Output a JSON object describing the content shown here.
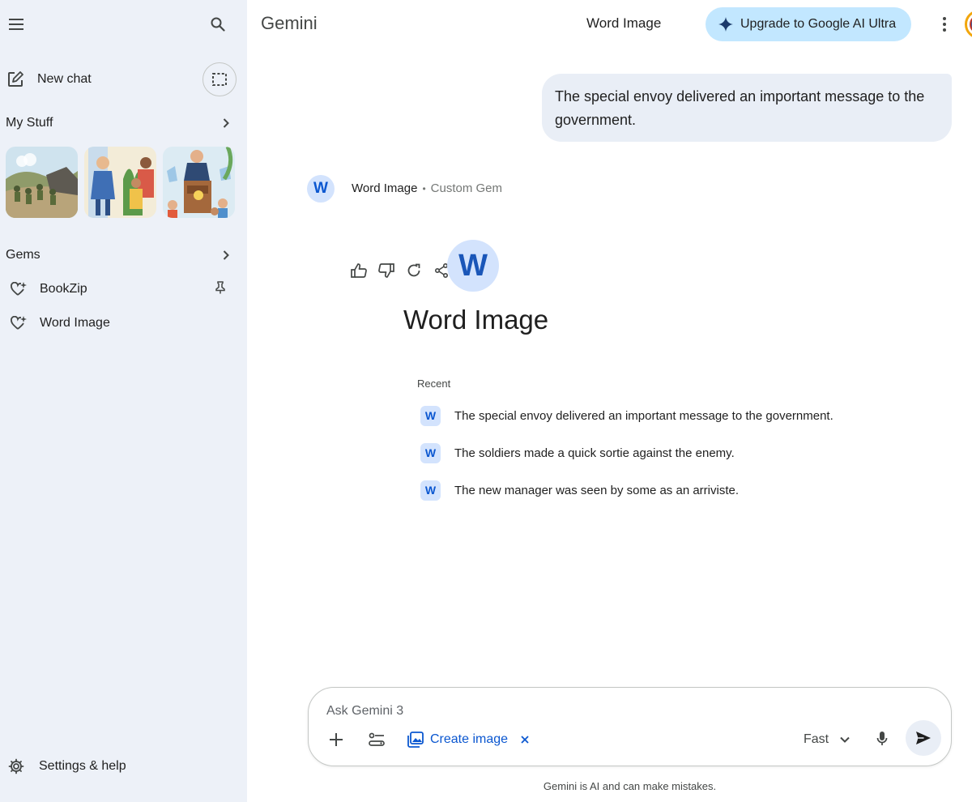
{
  "sidebar": {
    "new_chat_label": "New chat",
    "my_stuff_label": "My Stuff",
    "gems_label": "Gems",
    "gems": [
      {
        "label": "BookZip",
        "pinned": true
      },
      {
        "label": "Word Image",
        "pinned": false
      }
    ],
    "settings_label": "Settings & help",
    "icons": [
      "menu-icon",
      "search-icon",
      "edit-square-icon",
      "temporary-chat-icon",
      "chevron-right-icon",
      "gem-icon",
      "pin-icon",
      "gear-icon"
    ]
  },
  "header": {
    "app_title": "Gemini",
    "gem_title": "Word Image",
    "upgrade_label": "Upgrade to Google AI Ultra"
  },
  "conversation": {
    "user_message": "The special envoy delivered an important message to the government.",
    "response": {
      "avatar_letter": "W",
      "gem_name": "Word Image",
      "separator": "•",
      "gem_type": "Custom Gem"
    }
  },
  "gem_intro": {
    "avatar_letter": "W",
    "title": "Word Image",
    "recent_label": "Recent",
    "recent_items": [
      {
        "badge": "W",
        "text": "The special envoy delivered an important message to the government."
      },
      {
        "badge": "W",
        "text": "The soldiers made a quick sortie against the enemy."
      },
      {
        "badge": "W",
        "text": "The new manager was seen by some as an arriviste."
      }
    ]
  },
  "input": {
    "placeholder": "Ask Gemini 3",
    "value": "",
    "create_image_label": "Create image",
    "model_label": "Fast"
  },
  "footer": {
    "disclaimer": "Gemini is AI and can make mistakes."
  },
  "colors": {
    "sidebar_bg": "#edf1f8",
    "accent_blue": "#0b57d0",
    "upgrade_bg": "#c2e7ff",
    "bubble_bg": "#e9eef6",
    "avatar_bg": "#d3e3fd"
  }
}
